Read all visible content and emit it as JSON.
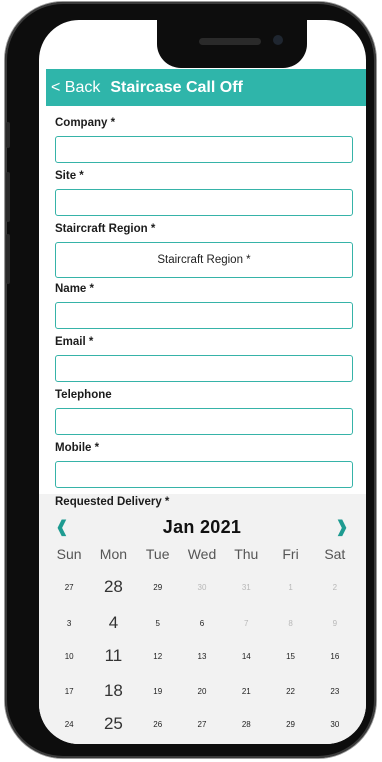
{
  "header": {
    "back_label": "< Back",
    "title": "Staircase Call Off"
  },
  "form": {
    "company_label": "Company *",
    "site_label": "Site *",
    "region_label": "Staircraft Region *",
    "region_value": "Staircraft Region *",
    "name_label": "Name *",
    "email_label": "Email *",
    "telephone_label": "Telephone",
    "mobile_label": "Mobile *",
    "delivery_label": "Requested Delivery *"
  },
  "calendar": {
    "month": "Jan 2021",
    "weekdays": [
      "Sun",
      "Mon",
      "Tue",
      "Wed",
      "Thu",
      "Fri",
      "Sat"
    ],
    "weeks": [
      [
        "27",
        "28",
        "29",
        "30",
        "31",
        "1",
        "2"
      ],
      [
        "3",
        "4",
        "5",
        "6",
        "7",
        "8",
        "9"
      ],
      [
        "10",
        "11",
        "12",
        "13",
        "14",
        "15",
        "16"
      ],
      [
        "17",
        "18",
        "19",
        "20",
        "21",
        "22",
        "23"
      ],
      [
        "24",
        "25",
        "26",
        "27",
        "28",
        "29",
        "30"
      ]
    ],
    "prev_icon": "chevron-left-icon",
    "next_icon": "chevron-right-icon"
  },
  "colors": {
    "accent": "#2fb5aa",
    "border": "#36b3a8"
  }
}
